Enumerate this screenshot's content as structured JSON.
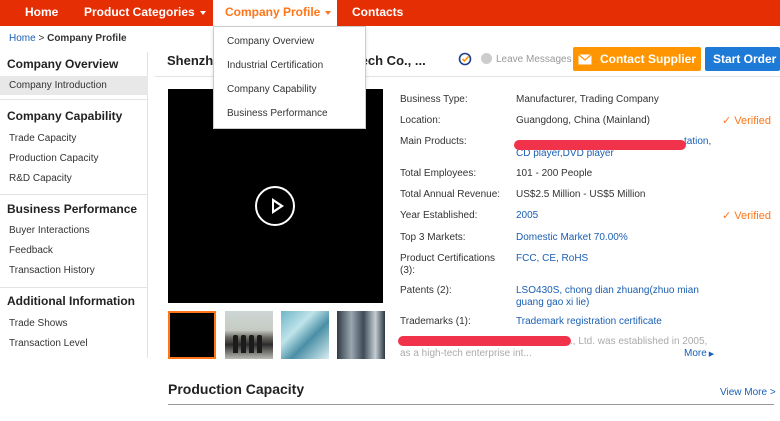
{
  "nav": {
    "home": "Home",
    "product_categories": "Product Categories",
    "company_profile": "Company Profile",
    "contacts": "Contacts",
    "dropdown": [
      "Company Overview",
      "Industrial Certification",
      "Company Capability",
      "Business Performance"
    ]
  },
  "breadcrumb": {
    "home": "Home",
    "separator": " > ",
    "current": "Company Profile"
  },
  "sidebar": {
    "sections": [
      {
        "heading": "Company Overview",
        "items": [
          "Company Introduction"
        ]
      },
      {
        "heading": "Company Capability",
        "items": [
          "Trade Capacity",
          "Production Capacity",
          "R&D Capacity"
        ]
      },
      {
        "heading": "Business Performance",
        "items": [
          "Buyer Interactions",
          "Feedback",
          "Transaction History"
        ]
      },
      {
        "heading": "Additional Information",
        "items": [
          "Trade Shows",
          "Transaction Level"
        ]
      }
    ]
  },
  "header": {
    "company_name_start": "Shenzh",
    "company_name_end": "ic Tech Co., ...",
    "leave_messages": "Leave Messages",
    "contact_supplier": "Contact Supplier",
    "start_order": "Start Order"
  },
  "details": {
    "business_type": {
      "label": "Business Type:",
      "value": "Manufacturer, Trading Company"
    },
    "location": {
      "label": "Location:",
      "value": "Guangdong, China (Mainland)",
      "verified": "Verified"
    },
    "main_products": {
      "label": "Main Products:",
      "value_end": "tation,",
      "value_line2": "CD player,DVD player"
    },
    "total_employees": {
      "label": "Total Employees:",
      "value": "101 - 200 People"
    },
    "revenue": {
      "label": "Total Annual Revenue:",
      "value": "US$2.5 Million - US$5 Million"
    },
    "year_established": {
      "label": "Year Established:",
      "value": "2005",
      "verified": "Verified"
    },
    "top_markets": {
      "label": "Top 3 Markets:",
      "value": "Domestic Market 70.00%"
    },
    "certifications": {
      "label": "Product Certifications (3):",
      "value": "FCC, CE, RoHS"
    },
    "patents": {
      "label": "Patents (2):",
      "value": "LSO430S, chong dian zhuang(zhuo mian guang gao xi lie)"
    },
    "trademarks": {
      "label": "Trademarks (1):",
      "value": "Trademark registration certificate"
    }
  },
  "intro": {
    "line1": "., Ltd. was established in 2005,",
    "line2": "as a high-tech enterprise int...",
    "more": "More"
  },
  "production": {
    "title": "Production Capacity",
    "view_more": "View More >"
  },
  "colors": {
    "nav_bg": "#e62e04",
    "accent": "#ff7519",
    "contact_btn": "#ff9500",
    "start_btn": "#1d7bd7",
    "link": "#1a5fb4"
  }
}
